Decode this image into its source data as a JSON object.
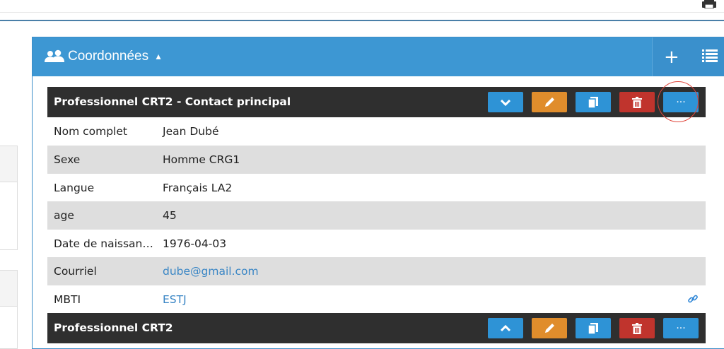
{
  "panel": {
    "title": "Coordonnées",
    "caret": "▲",
    "add_label": "+",
    "list_label": "☰"
  },
  "records": [
    {
      "title": "Professionnel CRT2 - Contact principal",
      "fields": [
        {
          "label": "Nom complet",
          "value": "Jean Dubé"
        },
        {
          "label": "Sexe",
          "value": "Homme CRG1"
        },
        {
          "label": "Langue",
          "value": "Français LA2"
        },
        {
          "label": "age",
          "value": "45"
        },
        {
          "label": "Date de naissan…",
          "value": "1976-04-03"
        },
        {
          "label": "Courriel",
          "value": "dube@gmail.com"
        },
        {
          "label": "MBTI",
          "value": "ESTJ"
        }
      ]
    },
    {
      "title": "Professionnel CRT2"
    }
  ],
  "buttons": {
    "more": "···"
  },
  "colors": {
    "header_blue": "#3d97d3",
    "record_header": "#2f2f2f",
    "btn_blue": "#2e93d6",
    "btn_orange": "#e08d2c",
    "btn_red": "#c0342d",
    "link": "#3a86c5",
    "highlight_circle": "#e0443a"
  },
  "icons": [
    "printer-icon",
    "users-icon",
    "plus-icon",
    "list-icon",
    "chevron-down-icon",
    "chevron-up-icon",
    "pencil-icon",
    "copy-icon",
    "trash-icon",
    "more-icon",
    "link-icon"
  ]
}
